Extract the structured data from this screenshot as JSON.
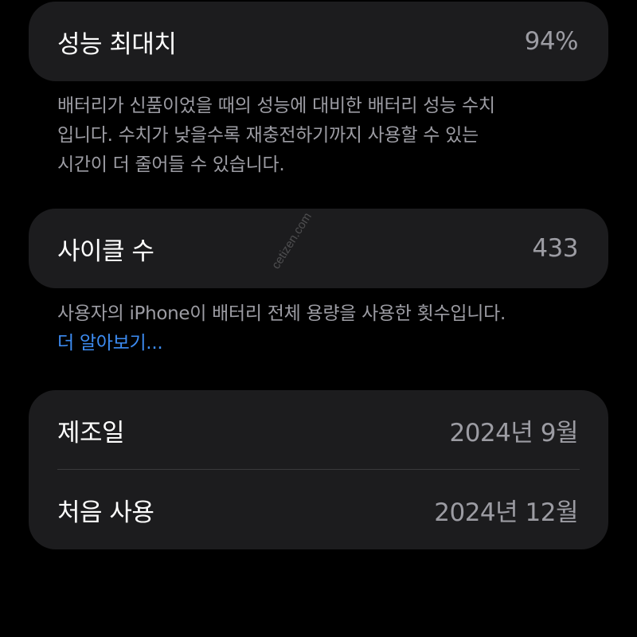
{
  "performance": {
    "label": "성능 최대치",
    "value": "94%",
    "footnote_lines": [
      "배터리가 신품이었을 때의 성능에 대비한 배터리 성능 수치",
      "입니다. 수치가 낮을수록 재충전하기까지 사용할 수 있는",
      "시간이 더 줄어들 수 있습니다."
    ]
  },
  "cycle": {
    "label": "사이클 수",
    "value": "433",
    "footnote": "사용자의 iPhone이 배터리 전체 용량을 사용한 횟수입니다.",
    "learn_more": "더 알아보기..."
  },
  "dates": {
    "manufacture_label": "제조일",
    "manufacture_value": "2024년 9월",
    "first_use_label": "처음 사용",
    "first_use_value": "2024년 12월"
  },
  "watermark": "cetizen.com",
  "colors": {
    "background": "#000000",
    "card": "#1c1c1e",
    "secondary_text": "#9c9ca3",
    "link": "#3d8cf2"
  }
}
